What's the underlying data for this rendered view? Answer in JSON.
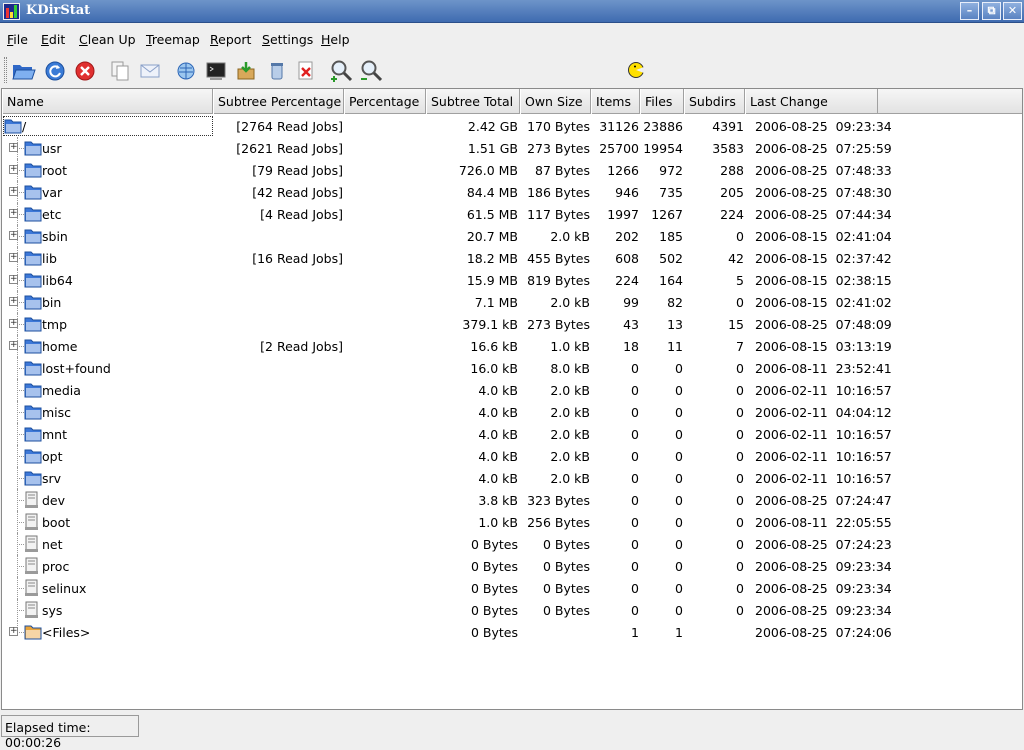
{
  "window": {
    "title": "KDirStat"
  },
  "menu": [
    "File",
    "Edit",
    "Clean Up",
    "Treemap",
    "Report",
    "Settings",
    "Help"
  ],
  "toolbar": {
    "buttons": [
      {
        "name": "open-folder",
        "icon": "open-folder-icon"
      },
      {
        "name": "refresh",
        "icon": "refresh-icon"
      },
      {
        "name": "stop",
        "icon": "stop-icon"
      },
      {
        "name": "copy",
        "icon": "copy-icon"
      },
      {
        "name": "mail",
        "icon": "mail-icon"
      },
      {
        "name": "konqueror",
        "icon": "konqueror-icon"
      },
      {
        "name": "terminal",
        "icon": "terminal-icon"
      },
      {
        "name": "compress",
        "icon": "compress-icon"
      },
      {
        "name": "trash",
        "icon": "trash-icon"
      },
      {
        "name": "delete",
        "icon": "delete-icon"
      },
      {
        "name": "zoom-in",
        "icon": "zoom-in-icon"
      },
      {
        "name": "zoom-out",
        "icon": "zoom-out-icon"
      }
    ],
    "status_indicator": "pacman-icon"
  },
  "columns": [
    "Name",
    "Subtree Percentage",
    "Percentage",
    "Subtree Total",
    "Own Size",
    "Items",
    "Files",
    "Subdirs",
    "Last Change"
  ],
  "rows": [
    {
      "name": "/",
      "subtree_pct": "[2764 Read Jobs]",
      "pct": "",
      "total": "2.42 GB",
      "own": "170 Bytes",
      "items": "31126",
      "files": "23886",
      "subdirs": "4391",
      "changed": "2006-08-25  09:23:34",
      "icon": "folder-open",
      "expand": false,
      "root": true
    },
    {
      "name": "usr",
      "subtree_pct": "[2621 Read Jobs]",
      "pct": "",
      "total": "1.51 GB",
      "own": "273 Bytes",
      "items": "25700",
      "files": "19954",
      "subdirs": "3583",
      "changed": "2006-08-25  07:25:59",
      "icon": "folder",
      "expand": true
    },
    {
      "name": "root",
      "subtree_pct": "[79 Read Jobs]",
      "pct": "",
      "total": "726.0 MB",
      "own": "87 Bytes",
      "items": "1266",
      "files": "972",
      "subdirs": "288",
      "changed": "2006-08-25  07:48:33",
      "icon": "folder",
      "expand": true
    },
    {
      "name": "var",
      "subtree_pct": "[42 Read Jobs]",
      "pct": "",
      "total": "84.4 MB",
      "own": "186 Bytes",
      "items": "946",
      "files": "735",
      "subdirs": "205",
      "changed": "2006-08-25  07:48:30",
      "icon": "folder",
      "expand": true
    },
    {
      "name": "etc",
      "subtree_pct": "[4 Read Jobs]",
      "pct": "",
      "total": "61.5 MB",
      "own": "117 Bytes",
      "items": "1997",
      "files": "1267",
      "subdirs": "224",
      "changed": "2006-08-25  07:44:34",
      "icon": "folder",
      "expand": true
    },
    {
      "name": "sbin",
      "subtree_pct": "",
      "pct": "",
      "total": "20.7 MB",
      "own": "2.0 kB",
      "items": "202",
      "files": "185",
      "subdirs": "0",
      "changed": "2006-08-15  02:41:04",
      "icon": "folder",
      "expand": true
    },
    {
      "name": "lib",
      "subtree_pct": "[16 Read Jobs]",
      "pct": "",
      "total": "18.2 MB",
      "own": "455 Bytes",
      "items": "608",
      "files": "502",
      "subdirs": "42",
      "changed": "2006-08-15  02:37:42",
      "icon": "folder",
      "expand": true
    },
    {
      "name": "lib64",
      "subtree_pct": "",
      "pct": "",
      "total": "15.9 MB",
      "own": "819 Bytes",
      "items": "224",
      "files": "164",
      "subdirs": "5",
      "changed": "2006-08-15  02:38:15",
      "icon": "folder",
      "expand": true
    },
    {
      "name": "bin",
      "subtree_pct": "",
      "pct": "",
      "total": "7.1 MB",
      "own": "2.0 kB",
      "items": "99",
      "files": "82",
      "subdirs": "0",
      "changed": "2006-08-15  02:41:02",
      "icon": "folder",
      "expand": true
    },
    {
      "name": "tmp",
      "subtree_pct": "",
      "pct": "",
      "total": "379.1 kB",
      "own": "273 Bytes",
      "items": "43",
      "files": "13",
      "subdirs": "15",
      "changed": "2006-08-25  07:48:09",
      "icon": "folder",
      "expand": true
    },
    {
      "name": "home",
      "subtree_pct": "[2 Read Jobs]",
      "pct": "",
      "total": "16.6 kB",
      "own": "1.0 kB",
      "items": "18",
      "files": "11",
      "subdirs": "7",
      "changed": "2006-08-15  03:13:19",
      "icon": "folder",
      "expand": true
    },
    {
      "name": "lost+found",
      "subtree_pct": "",
      "pct": "",
      "total": "16.0 kB",
      "own": "8.0 kB",
      "items": "0",
      "files": "0",
      "subdirs": "0",
      "changed": "2006-08-11  23:52:41",
      "icon": "folder",
      "expand": false
    },
    {
      "name": "media",
      "subtree_pct": "",
      "pct": "",
      "total": "4.0 kB",
      "own": "2.0 kB",
      "items": "0",
      "files": "0",
      "subdirs": "0",
      "changed": "2006-02-11  10:16:57",
      "icon": "folder",
      "expand": false
    },
    {
      "name": "misc",
      "subtree_pct": "",
      "pct": "",
      "total": "4.0 kB",
      "own": "2.0 kB",
      "items": "0",
      "files": "0",
      "subdirs": "0",
      "changed": "2006-02-11  04:04:12",
      "icon": "folder",
      "expand": false
    },
    {
      "name": "mnt",
      "subtree_pct": "",
      "pct": "",
      "total": "4.0 kB",
      "own": "2.0 kB",
      "items": "0",
      "files": "0",
      "subdirs": "0",
      "changed": "2006-02-11  10:16:57",
      "icon": "folder",
      "expand": false
    },
    {
      "name": "opt",
      "subtree_pct": "",
      "pct": "",
      "total": "4.0 kB",
      "own": "2.0 kB",
      "items": "0",
      "files": "0",
      "subdirs": "0",
      "changed": "2006-02-11  10:16:57",
      "icon": "folder",
      "expand": false
    },
    {
      "name": "srv",
      "subtree_pct": "",
      "pct": "",
      "total": "4.0 kB",
      "own": "2.0 kB",
      "items": "0",
      "files": "0",
      "subdirs": "0",
      "changed": "2006-02-11  10:16:57",
      "icon": "folder",
      "expand": false
    },
    {
      "name": "dev",
      "subtree_pct": "",
      "pct": "",
      "total": "3.8 kB",
      "own": "323 Bytes",
      "items": "0",
      "files": "0",
      "subdirs": "0",
      "changed": "2006-08-25  07:24:47",
      "icon": "mount",
      "expand": false
    },
    {
      "name": "boot",
      "subtree_pct": "",
      "pct": "",
      "total": "1.0 kB",
      "own": "256 Bytes",
      "items": "0",
      "files": "0",
      "subdirs": "0",
      "changed": "2006-08-11  22:05:55",
      "icon": "mount",
      "expand": false
    },
    {
      "name": "net",
      "subtree_pct": "",
      "pct": "",
      "total": "0 Bytes",
      "own": "0 Bytes",
      "items": "0",
      "files": "0",
      "subdirs": "0",
      "changed": "2006-08-25  07:24:23",
      "icon": "mount",
      "expand": false
    },
    {
      "name": "proc",
      "subtree_pct": "",
      "pct": "",
      "total": "0 Bytes",
      "own": "0 Bytes",
      "items": "0",
      "files": "0",
      "subdirs": "0",
      "changed": "2006-08-25  09:23:34",
      "icon": "mount",
      "expand": false
    },
    {
      "name": "selinux",
      "subtree_pct": "",
      "pct": "",
      "total": "0 Bytes",
      "own": "0 Bytes",
      "items": "0",
      "files": "0",
      "subdirs": "0",
      "changed": "2006-08-25  09:23:34",
      "icon": "mount",
      "expand": false
    },
    {
      "name": "sys",
      "subtree_pct": "",
      "pct": "",
      "total": "0 Bytes",
      "own": "0 Bytes",
      "items": "0",
      "files": "0",
      "subdirs": "0",
      "changed": "2006-08-25  09:23:34",
      "icon": "mount",
      "expand": false
    },
    {
      "name": "<Files>",
      "subtree_pct": "",
      "pct": "",
      "total": "0 Bytes",
      "own": "",
      "items": "1",
      "files": "1",
      "subdirs": "",
      "changed": "2006-08-25  07:24:06",
      "icon": "files-folder",
      "expand": true
    }
  ],
  "status": {
    "elapsed": "Elapsed time: 00:00:26"
  },
  "colors": {
    "title_bar": "#4f7abd",
    "folder": "#3d78d8",
    "files_folder": "#e8a33a"
  }
}
